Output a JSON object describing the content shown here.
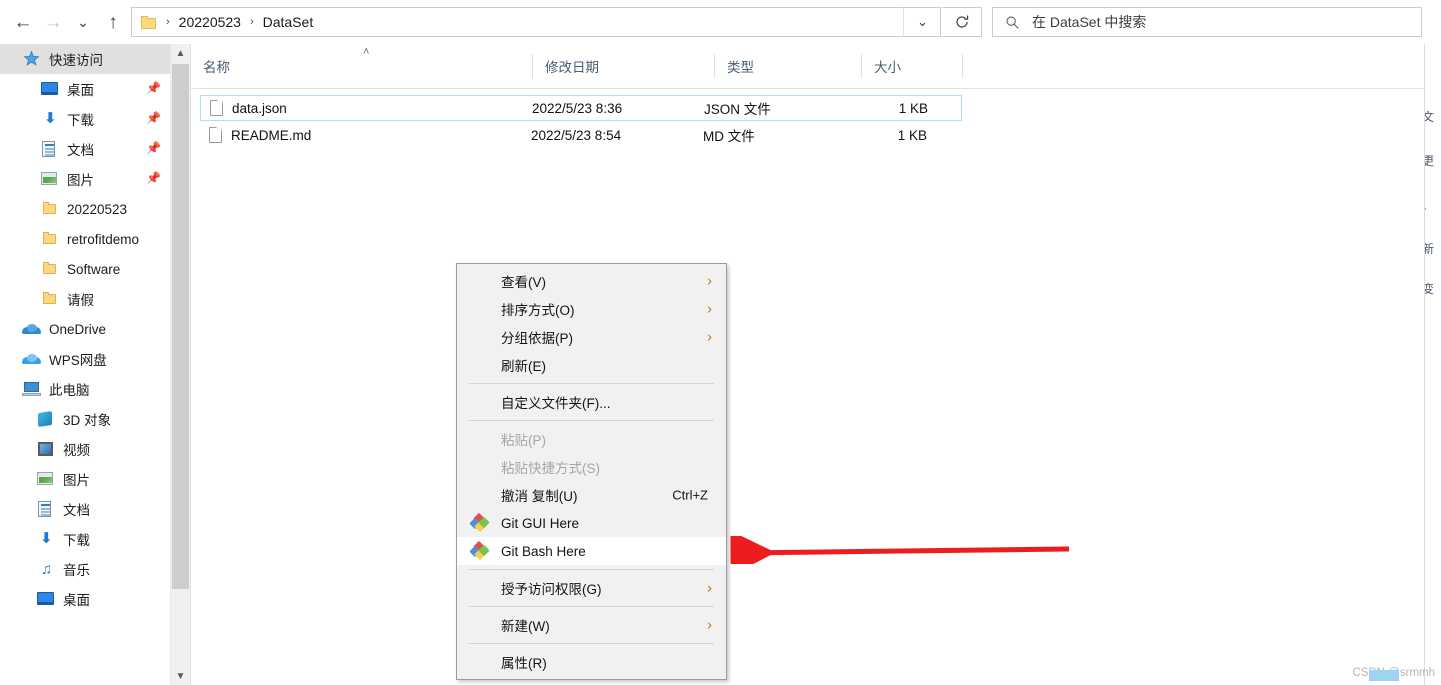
{
  "window": {
    "title": "DataSet"
  },
  "toolbar": {
    "back_icon": "arrow-left-icon",
    "forward_icon": "arrow-right-icon",
    "recent_icon": "chevron-down-icon",
    "up_icon": "arrow-up-icon",
    "refresh_icon": "refresh-icon"
  },
  "breadcrumb": {
    "folder_icon": "folder-icon",
    "separator": "›",
    "items": [
      "20220523",
      "DataSet"
    ],
    "dropdown_icon": "chevron-down-icon"
  },
  "search": {
    "icon": "search-icon",
    "placeholder": "在 DataSet 中搜索",
    "value": ""
  },
  "sidebar": {
    "scroll_up_icon": "chevron-up-icon",
    "scroll_down_icon": "chevron-down-icon",
    "pin_icon": "pin-icon",
    "items": [
      {
        "label": "快速访问",
        "icon": "quick-access-icon",
        "indent": 0,
        "header": true,
        "pinned": false
      },
      {
        "label": "桌面",
        "icon": "desktop-icon",
        "indent": 1,
        "header": false,
        "pinned": true
      },
      {
        "label": "下载",
        "icon": "downloads-icon",
        "indent": 1,
        "header": false,
        "pinned": true
      },
      {
        "label": "文档",
        "icon": "documents-icon",
        "indent": 1,
        "header": false,
        "pinned": true
      },
      {
        "label": "图片",
        "icon": "pictures-icon",
        "indent": 1,
        "header": false,
        "pinned": true
      },
      {
        "label": "20220523",
        "icon": "folder-icon",
        "indent": 1,
        "header": false,
        "pinned": false
      },
      {
        "label": "retrofitdemo",
        "icon": "folder-icon",
        "indent": 1,
        "header": false,
        "pinned": false
      },
      {
        "label": "Software",
        "icon": "folder-icon",
        "indent": 1,
        "header": false,
        "pinned": false
      },
      {
        "label": "请假",
        "icon": "folder-icon",
        "indent": 1,
        "header": false,
        "pinned": false
      },
      {
        "label": "OneDrive",
        "icon": "onedrive-icon",
        "indent": 0,
        "header": false,
        "pinned": false
      },
      {
        "label": "WPS网盘",
        "icon": "wps-cloud-icon",
        "indent": 0,
        "header": false,
        "pinned": false
      },
      {
        "label": "此电脑",
        "icon": "this-pc-icon",
        "indent": 0,
        "header": false,
        "pinned": false
      },
      {
        "label": "3D 对象",
        "icon": "3d-objects-icon",
        "indent": 2,
        "header": false,
        "pinned": false
      },
      {
        "label": "视频",
        "icon": "videos-icon",
        "indent": 2,
        "header": false,
        "pinned": false
      },
      {
        "label": "图片",
        "icon": "pictures-icon",
        "indent": 2,
        "header": false,
        "pinned": false
      },
      {
        "label": "文档",
        "icon": "documents-icon",
        "indent": 2,
        "header": false,
        "pinned": false
      },
      {
        "label": "下载",
        "icon": "downloads-icon",
        "indent": 2,
        "header": false,
        "pinned": false
      },
      {
        "label": "音乐",
        "icon": "music-icon",
        "indent": 2,
        "header": false,
        "pinned": false
      },
      {
        "label": "桌面",
        "icon": "desktop-icon",
        "indent": 2,
        "header": false,
        "pinned": false
      }
    ]
  },
  "filelist": {
    "sort_indicator": "˄",
    "columns": [
      {
        "label": "名称",
        "key": "name"
      },
      {
        "label": "修改日期",
        "key": "date"
      },
      {
        "label": "类型",
        "key": "type"
      },
      {
        "label": "大小",
        "key": "size"
      }
    ],
    "rows": [
      {
        "name": "data.json",
        "date": "2022/5/23 8:36",
        "type": "JSON 文件",
        "size": "1 KB",
        "icon": "file-icon",
        "selected": true
      },
      {
        "name": "README.md",
        "date": "2022/5/23 8:54",
        "type": "MD 文件",
        "size": "1 KB",
        "icon": "file-icon",
        "selected": false
      }
    ]
  },
  "context_menu": {
    "items": [
      {
        "label": "查看(V)",
        "type": "item",
        "submenu": true,
        "disabled": false,
        "highlighted": false,
        "icon": null,
        "accel": null
      },
      {
        "label": "排序方式(O)",
        "type": "item",
        "submenu": true,
        "disabled": false,
        "highlighted": false,
        "icon": null,
        "accel": null
      },
      {
        "label": "分组依据(P)",
        "type": "item",
        "submenu": true,
        "disabled": false,
        "highlighted": false,
        "icon": null,
        "accel": null
      },
      {
        "label": "刷新(E)",
        "type": "item",
        "submenu": false,
        "disabled": false,
        "highlighted": false,
        "icon": null,
        "accel": null
      },
      {
        "label": "",
        "type": "separator"
      },
      {
        "label": "自定义文件夹(F)...",
        "type": "item",
        "submenu": false,
        "disabled": false,
        "highlighted": false,
        "icon": null,
        "accel": null
      },
      {
        "label": "",
        "type": "separator"
      },
      {
        "label": "粘贴(P)",
        "type": "item",
        "submenu": false,
        "disabled": true,
        "highlighted": false,
        "icon": null,
        "accel": null
      },
      {
        "label": "粘贴快捷方式(S)",
        "type": "item",
        "submenu": false,
        "disabled": true,
        "highlighted": false,
        "icon": null,
        "accel": null
      },
      {
        "label": "撤消 复制(U)",
        "type": "item",
        "submenu": false,
        "disabled": false,
        "highlighted": false,
        "icon": null,
        "accel": "Ctrl+Z"
      },
      {
        "label": "Git GUI Here",
        "type": "item",
        "submenu": false,
        "disabled": false,
        "highlighted": false,
        "icon": "git-icon",
        "accel": null
      },
      {
        "label": "Git Bash Here",
        "type": "item",
        "submenu": false,
        "disabled": false,
        "highlighted": true,
        "icon": "git-icon",
        "accel": null
      },
      {
        "label": "",
        "type": "separator"
      },
      {
        "label": "授予访问权限(G)",
        "type": "item",
        "submenu": true,
        "disabled": false,
        "highlighted": false,
        "icon": null,
        "accel": null
      },
      {
        "label": "",
        "type": "separator"
      },
      {
        "label": "新建(W)",
        "type": "item",
        "submenu": true,
        "disabled": false,
        "highlighted": false,
        "icon": null,
        "accel": null
      },
      {
        "label": "",
        "type": "separator"
      },
      {
        "label": "属性(R)",
        "type": "item",
        "submenu": false,
        "disabled": false,
        "highlighted": false,
        "icon": null,
        "accel": null
      }
    ],
    "submenu_arrow": "›"
  },
  "annotation": {
    "arrow_color": "#ee1c1c",
    "points_to": "Git Bash Here"
  },
  "watermark": {
    "text": "CSDN @srmmh"
  }
}
